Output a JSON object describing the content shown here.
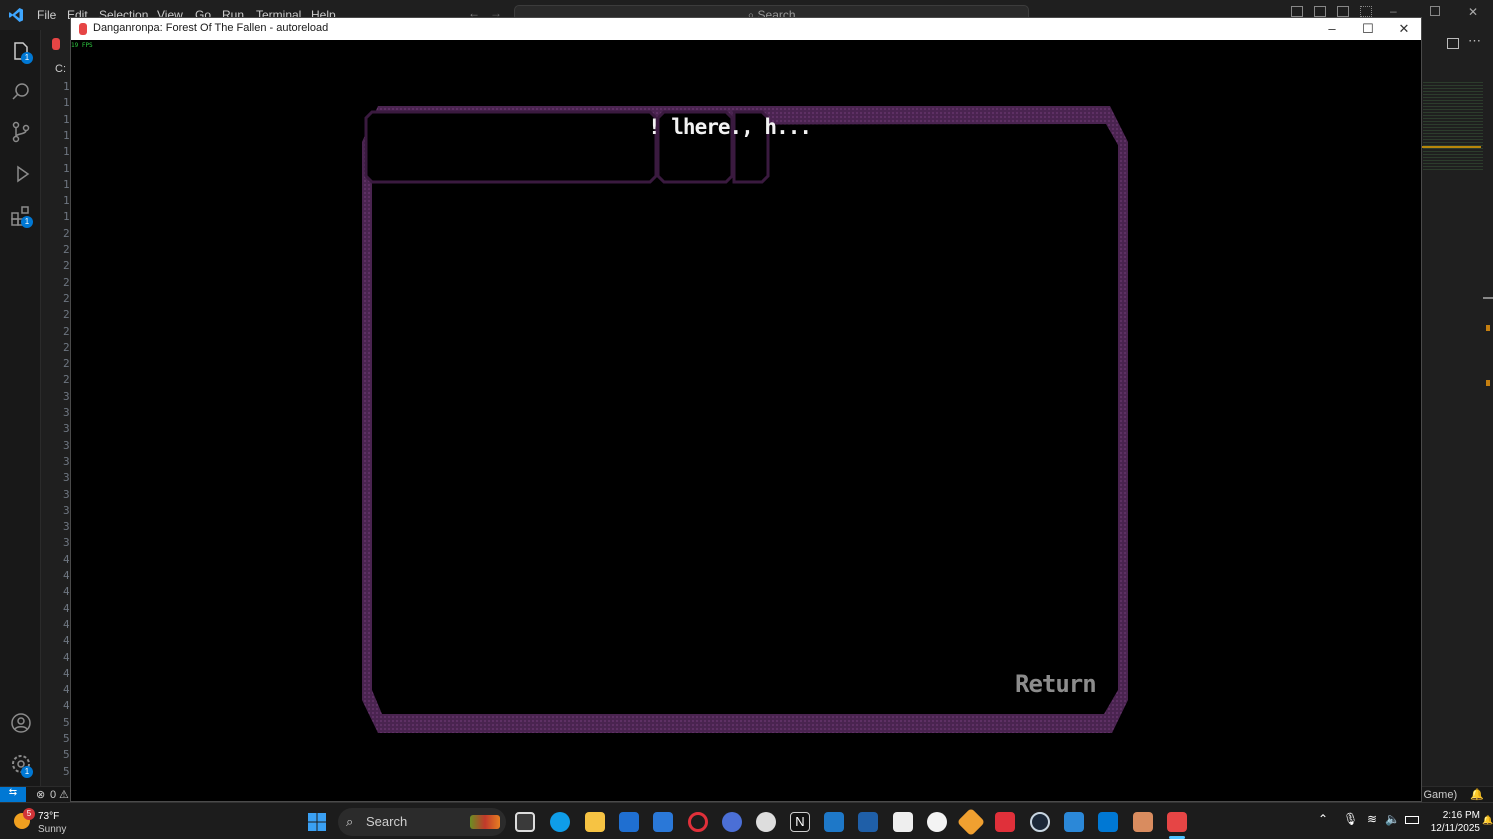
{
  "vscode": {
    "menu": [
      "File",
      "Edit",
      "Selection",
      "View",
      "Go",
      "Run",
      "Terminal",
      "Help"
    ],
    "search_placeholder": "Search",
    "tab_partial": "C:",
    "line_numbers": [
      "1",
      "1",
      "1",
      "1",
      "1",
      "1",
      "1",
      "1",
      "1",
      "2",
      "2",
      "2",
      "2",
      "2",
      "2",
      "2",
      "2",
      "2",
      "2",
      "3",
      "3",
      "3",
      "3",
      "3",
      "3",
      "3",
      "3",
      "3",
      "3",
      "4",
      "4",
      "4",
      "4",
      "4",
      "4",
      "4",
      "4",
      "4",
      "4",
      "5",
      "5",
      "5",
      "5"
    ],
    "badges": {
      "explorer": "1",
      "extensions": "1",
      "settings": "1"
    },
    "status": {
      "errors": "0",
      "warnings": "0",
      "right_text": "l Game)"
    }
  },
  "game": {
    "window_title": "Danganronpa: Forest Of The Fallen - autoreload",
    "fps_text": "19 FPS",
    "menu_label": "! lhere., h...",
    "return_label": "Return",
    "frame_color": "#5a2a5e"
  },
  "taskbar": {
    "weather_temp": "73°F",
    "weather_desc": "Sunny",
    "weather_badge": "5",
    "search_label": "Search",
    "time": "2:16 PM",
    "date": "12/11/2025"
  }
}
